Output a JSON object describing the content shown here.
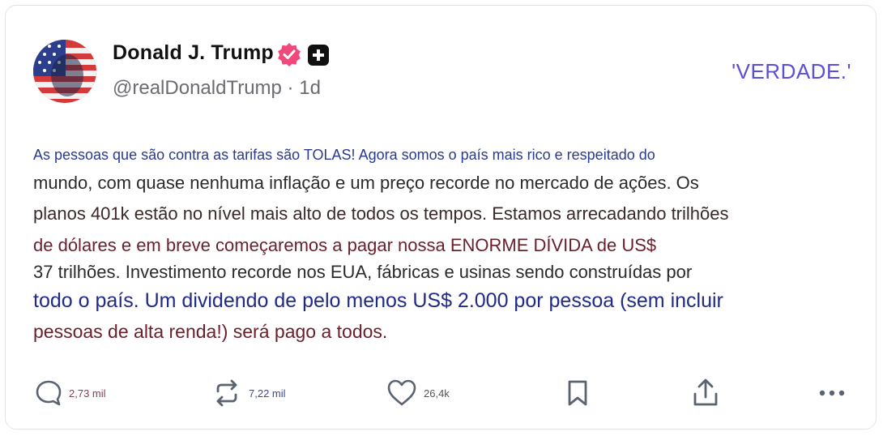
{
  "post": {
    "author_name": "Donald J. Trump",
    "handle_line": "@realDonaldTrump · 1d",
    "tag": "'VERDADE.'",
    "lines": [
      "As pessoas que são contra as tarifas são TOLAS! Agora somos o país mais rico e respeitado do",
      "mundo, com quase nenhuma inflação e um preço recorde no mercado de ações. Os",
      "planos 401k estão no nível mais alto de todos os tempos. Estamos arrecadando trilhões",
      "de dólares e em breve começaremos a pagar nossa ENORME DÍVIDA de US$",
      "37 trilhões. Investimento recorde nos EUA, fábricas e usinas sendo construídas por",
      "todo o país. Um dividendo de pelo menos US$ 2.000 por pessoa (sem incluir",
      "pessoas de alta renda!) será pago a todos."
    ]
  },
  "actions": {
    "replies": "2,73 mil",
    "reposts": "7,22 mil",
    "likes": "26,4k"
  },
  "icons": [
    "avatar-flag",
    "verified-badge",
    "plus-badge",
    "reply-icon",
    "repost-icon",
    "like-icon",
    "bookmark-icon",
    "share-icon",
    "more-icon"
  ],
  "colors": {
    "verified": "#f0487a",
    "accent": "#5b4fd6",
    "text": "#111111"
  }
}
